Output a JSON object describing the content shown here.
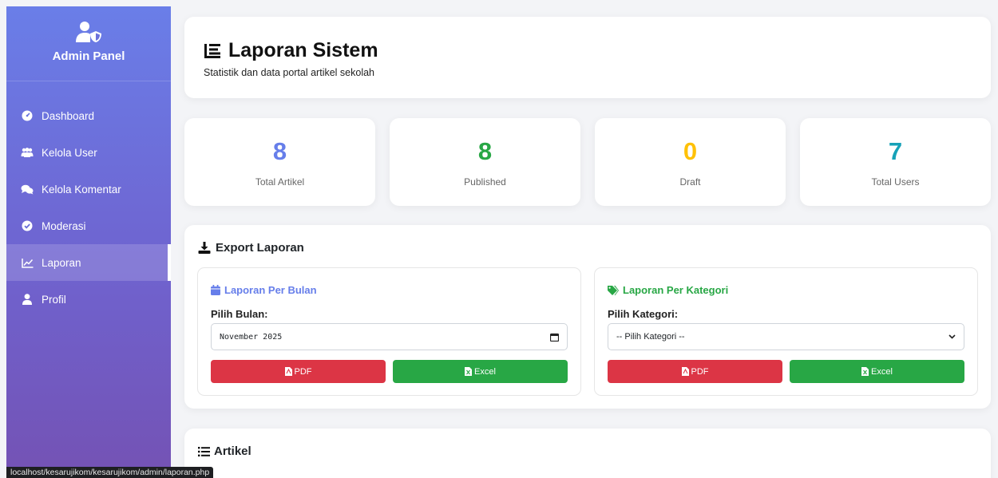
{
  "sidebar": {
    "brand": "Admin Panel",
    "items": [
      {
        "label": "Dashboard",
        "icon": "tachometer-icon"
      },
      {
        "label": "Kelola User",
        "icon": "users-icon"
      },
      {
        "label": "Kelola Komentar",
        "icon": "comments-icon"
      },
      {
        "label": "Moderasi",
        "icon": "check-circle-icon"
      },
      {
        "label": "Laporan",
        "icon": "chart-line-icon",
        "active": true
      },
      {
        "label": "Profil",
        "icon": "user-icon"
      }
    ]
  },
  "header": {
    "title": "Laporan Sistem",
    "subtitle": "Statistik dan data portal artikel sekolah"
  },
  "stats": [
    {
      "value": "8",
      "label": "Total Artikel",
      "color": "#667eea"
    },
    {
      "value": "8",
      "label": "Published",
      "color": "#28a745"
    },
    {
      "value": "0",
      "label": "Draft",
      "color": "#ffc107"
    },
    {
      "value": "7",
      "label": "Total Users",
      "color": "#17a2b8"
    }
  ],
  "export": {
    "title": "Export Laporan",
    "monthly": {
      "title": "Laporan Per Bulan",
      "label": "Pilih Bulan:",
      "value": "November 2025",
      "pdf": "PDF",
      "excel": "Excel"
    },
    "category": {
      "title": "Laporan Per Kategori",
      "label": "Pilih Kategori:",
      "value": "-- Pilih Kategori --",
      "pdf": "PDF",
      "excel": "Excel"
    }
  },
  "artikel": {
    "title": "Artikel"
  },
  "status_url": "localhost/kesarujikom/kesarujikom/admin/laporan.php",
  "colors": {
    "sidebar_top": "#6a7ee8",
    "sidebar_bottom": "#7452b4",
    "pdf": "#dc3545",
    "excel": "#28a745",
    "monthly_accent": "#667eea",
    "category_accent": "#28a745"
  }
}
